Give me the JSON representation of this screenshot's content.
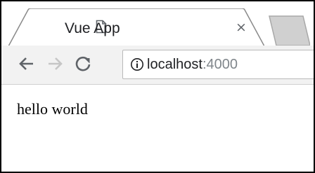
{
  "tab": {
    "title": "Vue App",
    "favicon_icon": "page-icon",
    "close_label": "×"
  },
  "toolbar": {
    "back_icon": "arrow-left-icon",
    "forward_icon": "arrow-right-icon",
    "reload_icon": "reload-icon"
  },
  "address_bar": {
    "security_icon": "info-icon",
    "host": "localhost",
    "port": ":4000"
  },
  "page": {
    "text": "hello world"
  },
  "colors": {
    "tab_strip": "#ffffff",
    "toolbar": "#f2f2f2",
    "inactive_tab": "#d0d0d0",
    "icon_active": "#5f6368",
    "icon_disabled": "#c6c6c6",
    "frame_border": "#000000"
  }
}
